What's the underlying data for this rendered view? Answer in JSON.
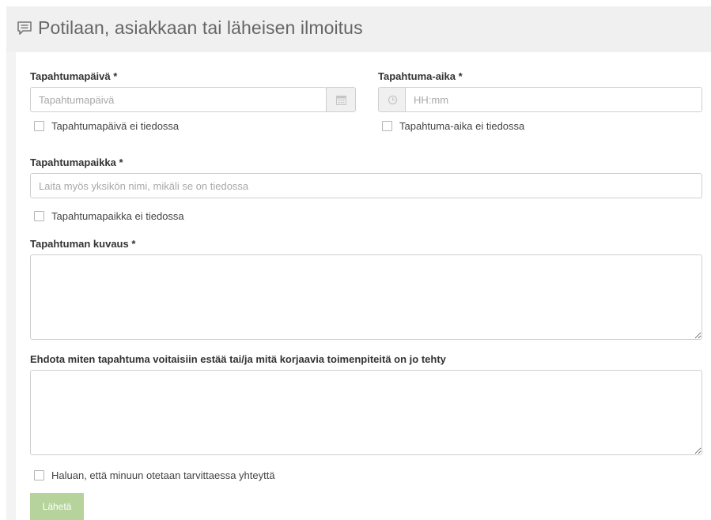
{
  "header": {
    "title": "Potilaan, asiakkaan tai läheisen ilmoitus",
    "icon": "comment-icon"
  },
  "form": {
    "date": {
      "label": "Tapahtumapäivä *",
      "placeholder": "Tapahtumapäivä",
      "value": "",
      "icon": "calendar-icon",
      "unknown_label": "Tapahtumapäivä ei tiedossa",
      "unknown_checked": false
    },
    "time": {
      "label": "Tapahtuma-aika *",
      "placeholder": "HH:mm",
      "value": "",
      "icon": "clock-icon",
      "unknown_label": "Tapahtuma-aika ei tiedossa",
      "unknown_checked": false
    },
    "place": {
      "label": "Tapahtumapaikka *",
      "placeholder": "Laita myös yksikön nimi, mikäli se on tiedossa",
      "value": "",
      "unknown_label": "Tapahtumapaikka ei tiedossa",
      "unknown_checked": false
    },
    "description": {
      "label": "Tapahtuman kuvaus *",
      "value": ""
    },
    "suggestion": {
      "label": "Ehdota miten tapahtuma voitaisiin estää tai/ja mitä korjaavia toimenpiteitä on jo tehty",
      "value": ""
    },
    "contact": {
      "label": "Haluan, että minuun otetaan tarvittaessa yhteyttä",
      "checked": false
    },
    "submit_label": "Lähetä"
  },
  "colors": {
    "submit_bg": "#b5d39b",
    "header_bg": "#f0f0f0",
    "border": "#cfcfcf"
  }
}
